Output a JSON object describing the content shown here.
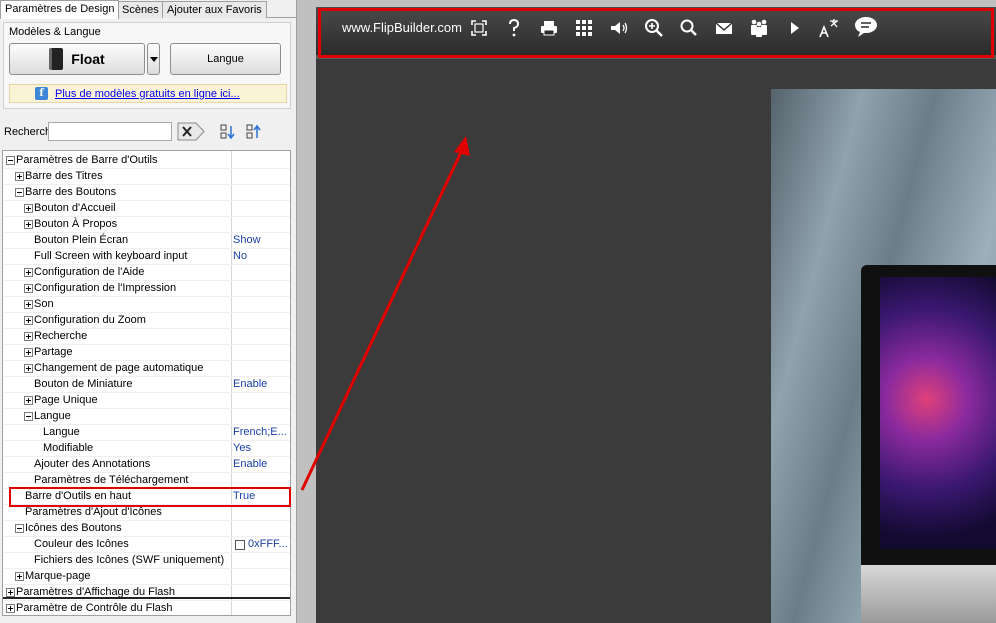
{
  "tabs": [
    {
      "label": "Paramètres de Design"
    },
    {
      "label": "Scènes"
    },
    {
      "label": "Ajouter aux Favoris"
    }
  ],
  "models": {
    "group_title": "Modèles & Langue",
    "template_label": "Float",
    "language_button": "Langue",
    "info_link": "Plus de modèles gratuits en ligne ici..."
  },
  "search": {
    "label": "Recherch",
    "value": ""
  },
  "tree": [
    {
      "name": "Paramètres de Barre d'Outils",
      "value": "",
      "expander": "minus"
    },
    {
      "name": "Barre des Titres",
      "value": "",
      "expander": "plus"
    },
    {
      "name": "Barre des Boutons",
      "value": "",
      "expander": "minus"
    },
    {
      "name": "Bouton d'Accueil",
      "value": "",
      "expander": "plus"
    },
    {
      "name": "Bouton À Propos",
      "value": "",
      "expander": "plus"
    },
    {
      "name": "Bouton Plein Écran",
      "value": "Show",
      "expander": ""
    },
    {
      "name": "Full Screen with keyboard input",
      "value": "No",
      "expander": ""
    },
    {
      "name": "Configuration de l'Aide",
      "value": "",
      "expander": "plus"
    },
    {
      "name": "Configuration de l'Impression",
      "value": "",
      "expander": "plus"
    },
    {
      "name": "Son",
      "value": "",
      "expander": "plus"
    },
    {
      "name": "Configuration du Zoom",
      "value": "",
      "expander": "plus"
    },
    {
      "name": "Recherche",
      "value": "",
      "expander": "plus"
    },
    {
      "name": "Partage",
      "value": "",
      "expander": "plus"
    },
    {
      "name": "Changement de page automatique",
      "value": "",
      "expander": "plus"
    },
    {
      "name": "Bouton de Miniature",
      "value": "Enable",
      "expander": ""
    },
    {
      "name": "Page Unique",
      "value": "",
      "expander": "plus"
    },
    {
      "name": "Langue",
      "value": "",
      "expander": "minus"
    },
    {
      "name": "Langue",
      "value": "French;E...",
      "expander": ""
    },
    {
      "name": "Modifiable",
      "value": "Yes",
      "expander": ""
    },
    {
      "name": "Ajouter des Annotations",
      "value": "Enable",
      "expander": ""
    },
    {
      "name": "Paramètres de Téléchargement",
      "value": "",
      "expander": ""
    },
    {
      "name": "Barre d'Outils en haut",
      "value": "True",
      "expander": ""
    },
    {
      "name": "Paramètres d'Ajout d'Icônes",
      "value": "",
      "expander": ""
    },
    {
      "name": "Icônes des Boutons",
      "value": "",
      "expander": "minus"
    },
    {
      "name": "Couleur des Icônes",
      "value": "0xFFF...",
      "expander": ""
    },
    {
      "name": "Fichiers des Icônes (SWF uniquement)",
      "value": "",
      "expander": ""
    },
    {
      "name": "Marque-page",
      "value": "",
      "expander": "plus"
    },
    {
      "name": "Paramètres d'Affichage du Flash",
      "value": "",
      "expander": "plus"
    },
    {
      "name": "Paramètre de Contrôle du Flash",
      "value": "",
      "expander": "plus"
    }
  ],
  "toolbar": {
    "site": "www.FlipBuilder.com",
    "icons": [
      "fullscreen-icon",
      "help-icon",
      "print-icon",
      "thumbnails-icon",
      "sound-icon",
      "zoom-in-icon",
      "search-icon",
      "email-icon",
      "share-icon",
      "autoflip-icon",
      "language-icon",
      "annotation-icon"
    ]
  },
  "colors": {
    "highlight": "#e00000",
    "toolbar_bg": "#2b2b2b",
    "value_text": "#1a3fa8"
  }
}
